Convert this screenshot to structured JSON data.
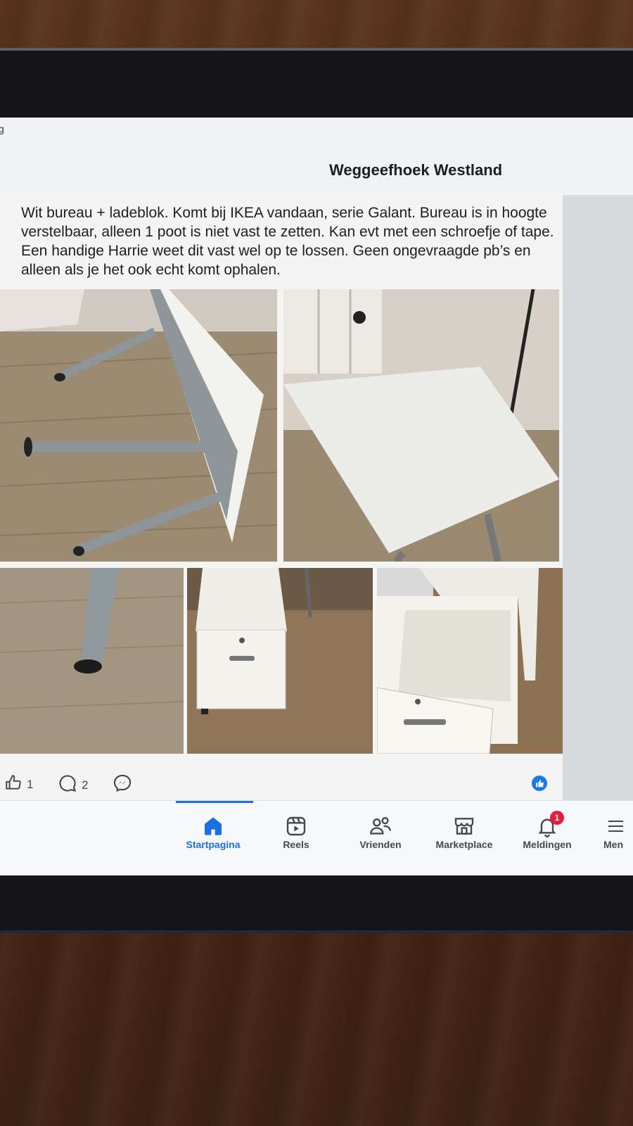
{
  "top_bar": {
    "side_glyph": "g",
    "group_name": "Weggeefhoek Westland"
  },
  "post": {
    "text": "Wit bureau + ladeblok. Komt bij IKEA vandaan, serie Galant. Bureau is in hoogte verstelbaar, alleen 1 poot is niet vast te zetten. Kan evt met een schroefje of tape. Een handige Harrie weet dit vast wel op te lossen. Geen ongevraagde pb’s en alleen als je het ook echt komt ophalen."
  },
  "actions": {
    "like_count": "1",
    "comment_count": "2",
    "like_icon": "thumbs-up-icon",
    "comment_icon": "comment-bubble-icon",
    "share_icon": "messenger-icon",
    "reaction_badge": "like-reaction-icon"
  },
  "nav": {
    "items": [
      {
        "label": "Startpagina",
        "icon": "home-icon",
        "active": true
      },
      {
        "label": "Reels",
        "icon": "reels-icon"
      },
      {
        "label": "Vrienden",
        "icon": "friends-icon"
      },
      {
        "label": "Marketplace",
        "icon": "marketplace-icon"
      },
      {
        "label": "Meldingen",
        "icon": "bell-icon",
        "badge": "1"
      },
      {
        "label": "Men",
        "icon": "menu-icon"
      }
    ]
  },
  "colors": {
    "accent": "#1b6fe0",
    "notification": "#e41e3f",
    "like": "#1877f2"
  }
}
